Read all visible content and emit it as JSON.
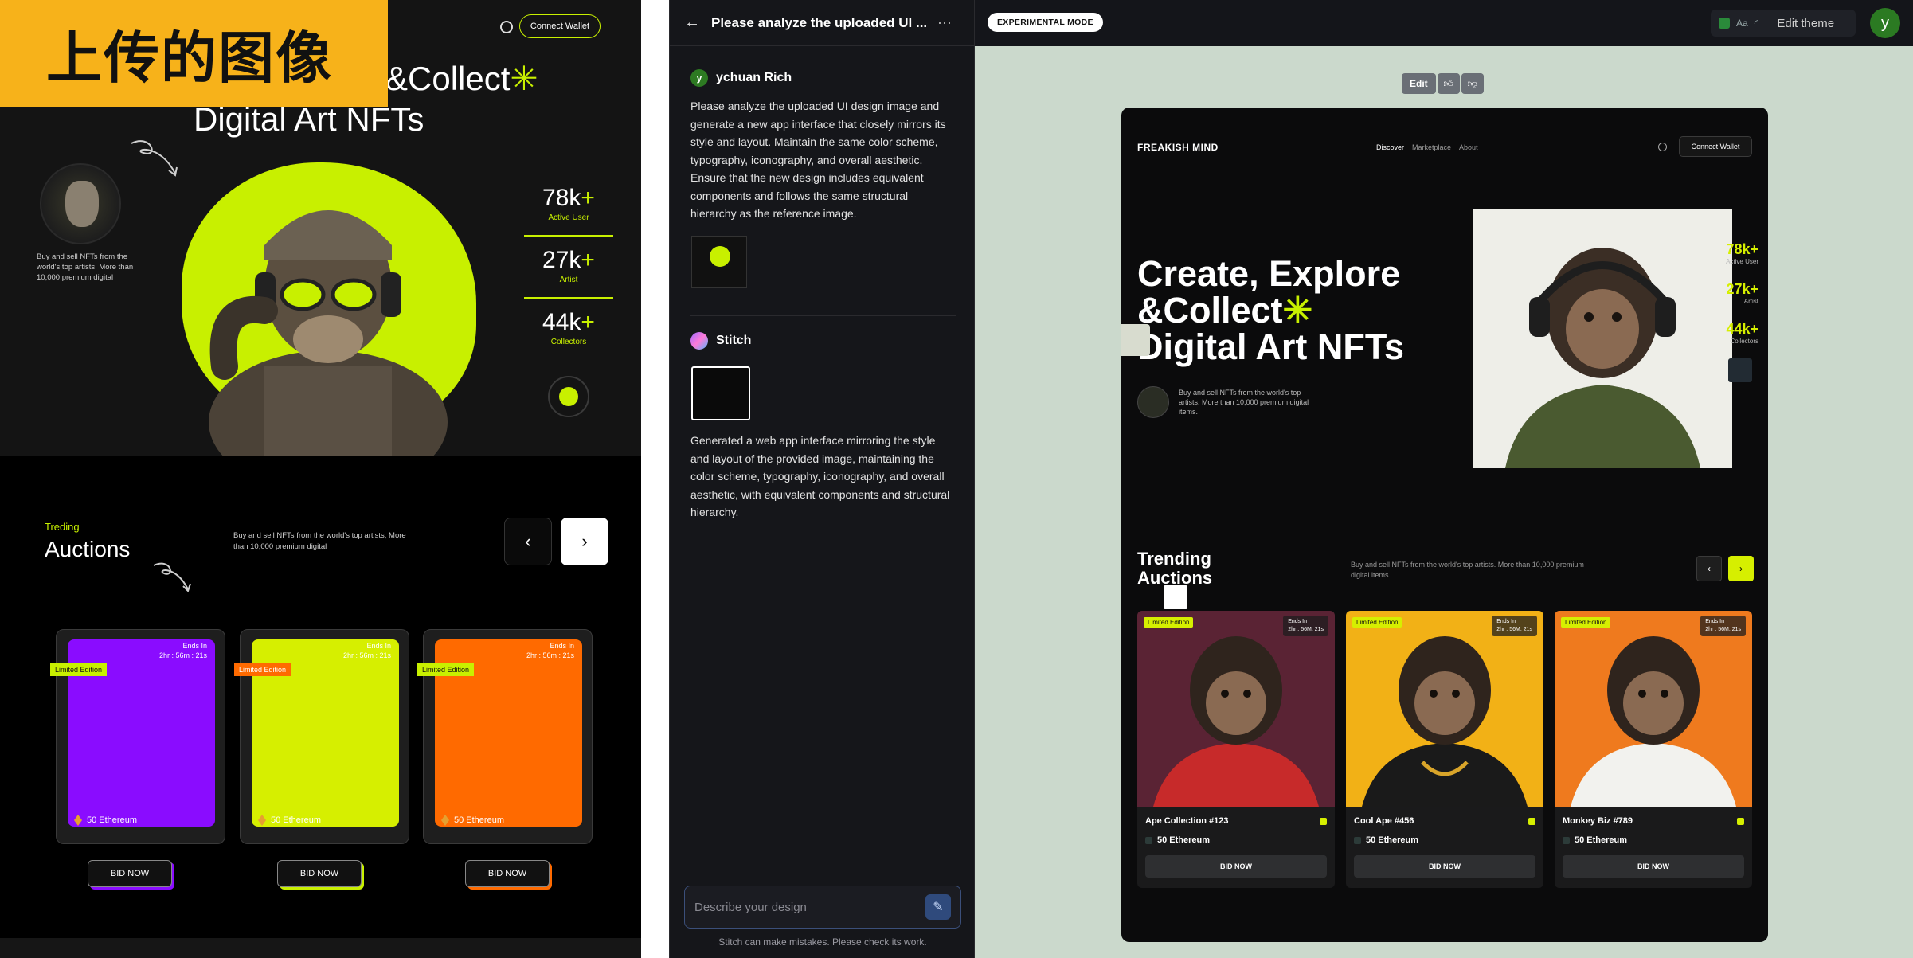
{
  "reference": {
    "badge": "上传的图像",
    "connect_wallet": "Connect Wallet",
    "headline_1": "&Collect",
    "headline_2": "Digital Art NFTs",
    "description": "Buy and sell NFTs from the world's top artists. More than 10,000 premium digital",
    "stats": [
      {
        "value": "78k",
        "suffix": "+",
        "label": "Active User"
      },
      {
        "value": "27k",
        "suffix": "+",
        "label": "Artist"
      },
      {
        "value": "44k",
        "suffix": "+",
        "label": "Collectors"
      }
    ],
    "trending_small": "Treding",
    "trending_big": "Auctions",
    "trending_desc": "Buy and sell NFTs from the world's top artists, More than 10,000 premium digital",
    "cards": [
      {
        "tag": "Limited Edition",
        "ends": "Ends In",
        "time": "2hr : 56m : 21s",
        "price": "50 Ethereum",
        "bid": "BID NOW",
        "color": "#8a0cff",
        "tag_color": "#c8f000"
      },
      {
        "tag": "Limited Edition",
        "ends": "Ends In",
        "time": "2hr : 56m : 21s",
        "price": "50 Ethereum",
        "bid": "BID NOW",
        "color": "#d6ef00",
        "tag_color": "#ff6a00"
      },
      {
        "tag": "Limited Edition",
        "ends": "Ends In",
        "time": "2hr : 56m : 21s",
        "price": "50 Ethereum",
        "bid": "BID NOW",
        "color": "#ff6a00",
        "tag_color": "#c8f000"
      }
    ]
  },
  "chat": {
    "title": "Please analyze the uploaded UI ...",
    "user_name": "ychuan Rich",
    "user_initial": "y",
    "user_message": "Please analyze the uploaded UI design image and generate a new app interface that closely mirrors its style and layout. Maintain the same color scheme, typography, iconography, and overall aesthetic. Ensure that the new design includes equivalent components and follows the same structural hierarchy as the reference image.",
    "bot_name": "Stitch",
    "bot_message": "Generated a web app interface mirroring the style and layout of the provided image, maintaining the color scheme, typography, iconography, and overall aesthetic, with equivalent components and structural hierarchy.",
    "input_placeholder": "Describe your design",
    "disclaimer": "Stitch can make mistakes. Please check its work."
  },
  "canvas": {
    "mode": "EXPERIMENTAL MODE",
    "theme_aa": "Aa",
    "edit_theme": "Edit theme",
    "avatar_initial": "y",
    "edit_label": "Edit",
    "accent": "#d6ef00"
  },
  "preview": {
    "logo": "FREAKISH MIND",
    "nav": [
      "Discover",
      "Marketplace",
      "About"
    ],
    "connect_wallet": "Connect Wallet",
    "headline_1": "Create, Explore",
    "headline_2": "&Collect",
    "headline_3": "Digital Art NFTs",
    "description": "Buy and sell NFTs from the world's top artists. More than 10,000 premium digital items.",
    "stats": [
      {
        "value": "78k+",
        "label": "Active User"
      },
      {
        "value": "27k+",
        "label": "Artist"
      },
      {
        "value": "44k+",
        "label": "Collectors"
      }
    ],
    "trending_1": "Trending",
    "trending_2": "Auctions",
    "trending_desc": "Buy and sell NFTs from the world's top artists. More than 10,000 premium digital items.",
    "cards": [
      {
        "tag": "Limited Edition",
        "ends": "Ends In",
        "time": "2hr : 56M: 21s",
        "name": "Ape Collection #123",
        "price": "50 Ethereum",
        "bid": "BID NOW",
        "bg": "#5a2334",
        "jacket": "#c72a2a"
      },
      {
        "tag": "Limited Edition",
        "ends": "Ends In",
        "time": "2hr : 56M: 21s",
        "name": "Cool Ape #456",
        "price": "50 Ethereum",
        "bid": "BID NOW",
        "bg": "#f2b116",
        "jacket": "#1a1a1a"
      },
      {
        "tag": "Limited Edition",
        "ends": "Ends In",
        "time": "2hr : 56M: 21s",
        "name": "Monkey Biz #789",
        "price": "50 Ethereum",
        "bid": "BID NOW",
        "bg": "#ef7a1e",
        "jacket": "#f2f2ee"
      }
    ]
  }
}
